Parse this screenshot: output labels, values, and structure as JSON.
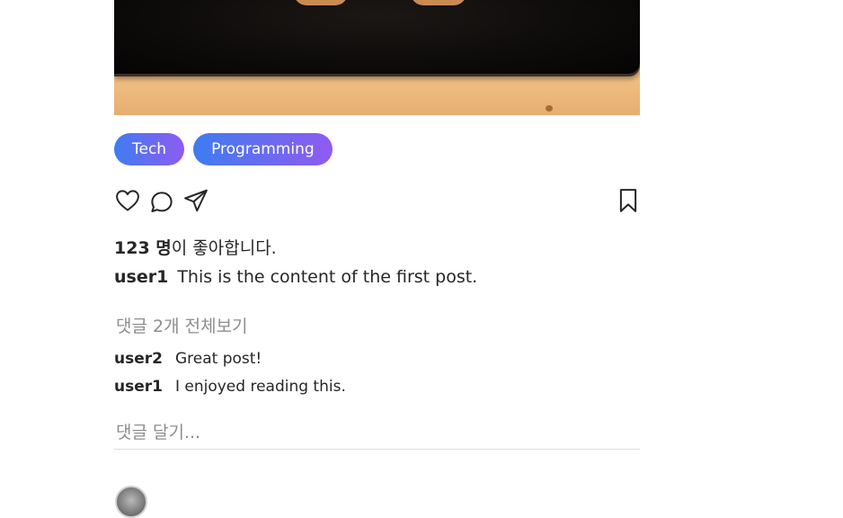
{
  "post": {
    "tags": [
      "Tech",
      "Programming"
    ],
    "likes": {
      "count": "123 명",
      "suffix": "이 좋아합니다."
    },
    "caption": {
      "username": "user1",
      "text": "This is the content of the first post."
    },
    "view_all_comments": "댓글 2개 전체보기",
    "comments": [
      {
        "username": "user2",
        "text": "Great post!"
      },
      {
        "username": "user1",
        "text": "I enjoyed reading this."
      }
    ],
    "add_comment_placeholder": "댓글 달기...",
    "icons": {
      "like": "heart-icon",
      "comment": "comment-bubble-icon",
      "share": "paper-plane-icon",
      "save": "bookmark-icon"
    }
  },
  "colors": {
    "tag_gradient_start": "#3f7cf0",
    "tag_gradient_end": "#8f5bf0",
    "muted_text": "#8e8e8e"
  }
}
